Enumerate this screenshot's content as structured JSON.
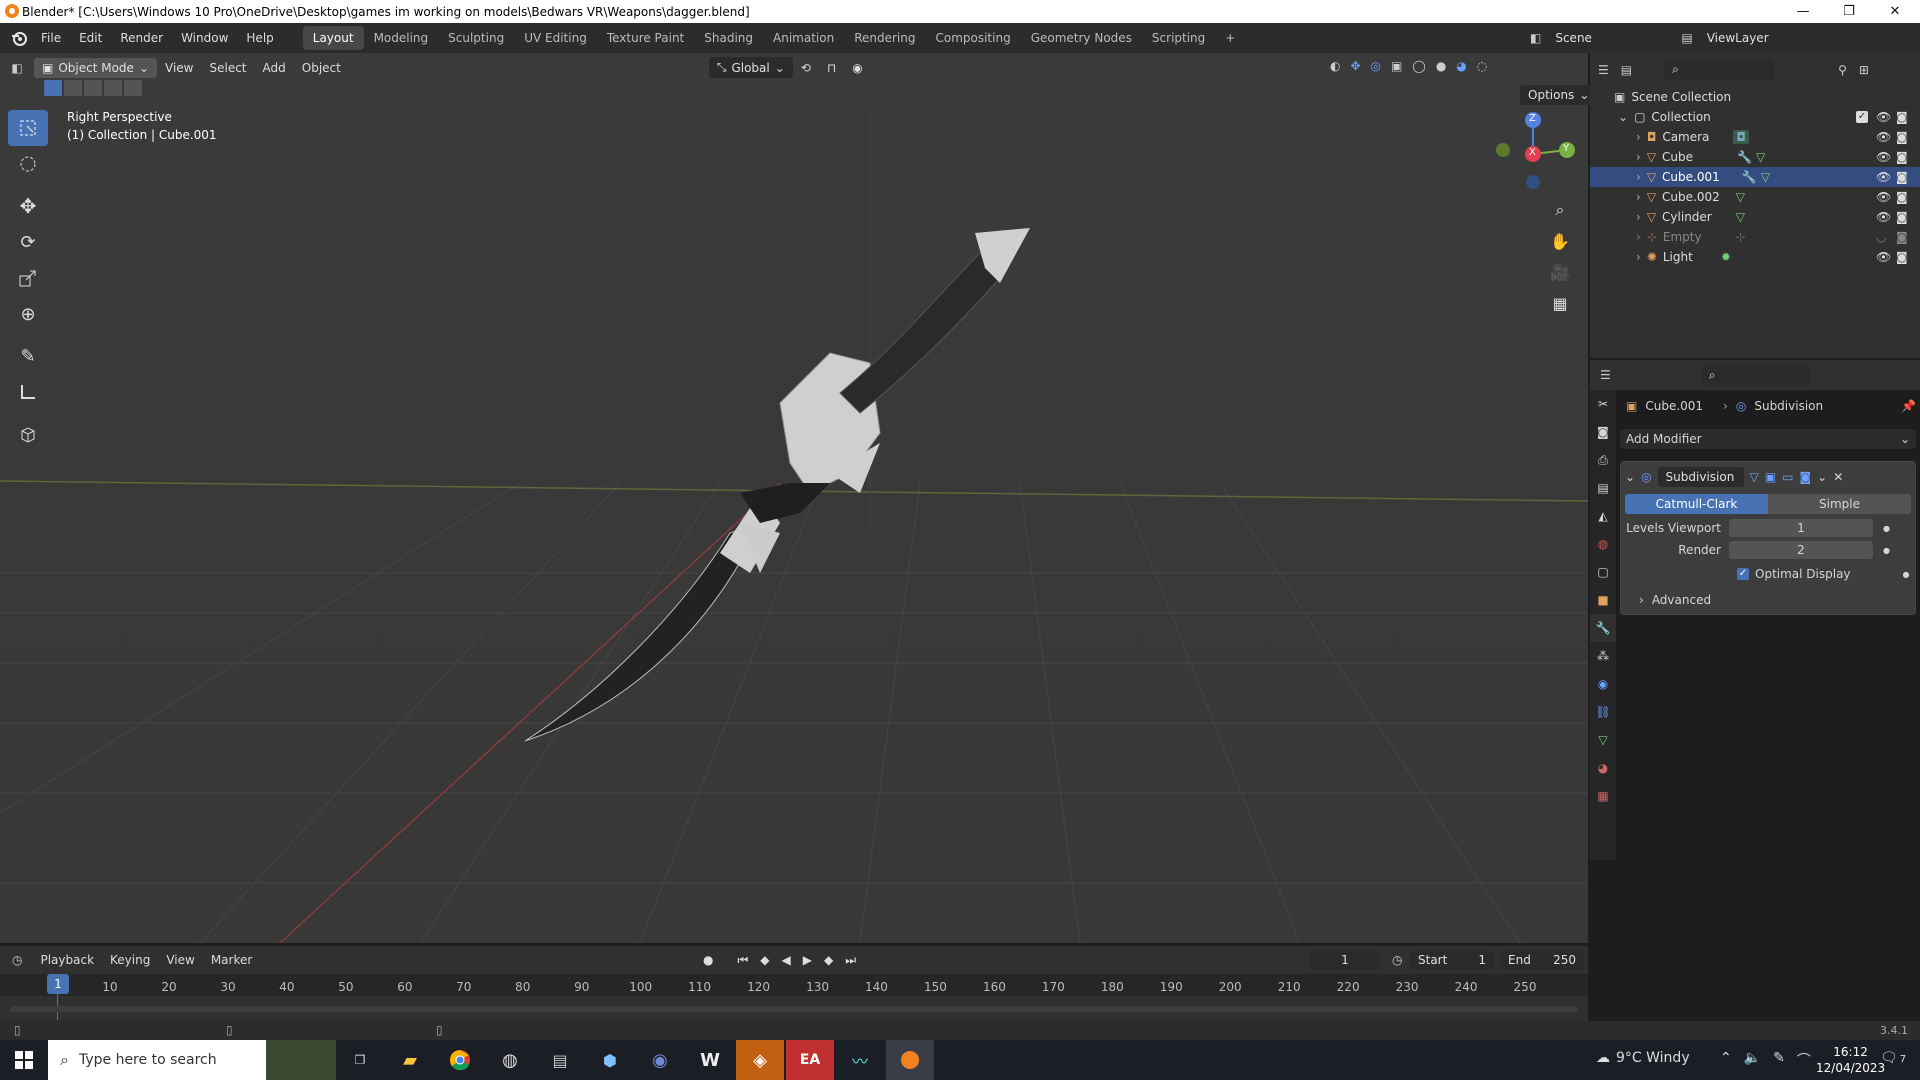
{
  "window": {
    "title": "Blender* [C:\\Users\\Windows 10 Pro\\OneDrive\\Desktop\\games im working on models\\Bedwars VR\\Weapons\\dagger.blend]",
    "controls": [
      "—",
      "❐",
      "✕"
    ]
  },
  "menubar": {
    "items": [
      "File",
      "Edit",
      "Render",
      "Window",
      "Help"
    ],
    "workspaces": [
      "Layout",
      "Modeling",
      "Sculpting",
      "UV Editing",
      "Texture Paint",
      "Shading",
      "Animation",
      "Rendering",
      "Compositing",
      "Geometry Nodes",
      "Scripting"
    ],
    "active_workspace": "Layout",
    "scene": "Scene",
    "view_layer": "ViewLayer"
  },
  "viewport": {
    "mode": "Object Mode",
    "menus": [
      "View",
      "Select",
      "Add",
      "Object"
    ],
    "orientation": "Global",
    "options_label": "Options",
    "info_line1": "Right Perspective",
    "info_line2": "(1) Collection | Cube.001",
    "gizmo_axes": [
      "Z",
      "Y",
      "X"
    ],
    "tools": [
      "select-box-icon",
      "cursor-icon",
      "move-icon",
      "rotate-icon",
      "scale-icon",
      "transform-icon",
      "annotate-icon",
      "measure-icon",
      "add-cube-icon"
    ]
  },
  "outliner": {
    "root": "Scene Collection",
    "collection": "Collection",
    "items": [
      {
        "name": "Camera",
        "type": "camera"
      },
      {
        "name": "Cube",
        "type": "mesh"
      },
      {
        "name": "Cube.001",
        "type": "mesh"
      },
      {
        "name": "Cube.002",
        "type": "mesh"
      },
      {
        "name": "Cylinder",
        "type": "mesh"
      },
      {
        "name": "Empty",
        "type": "empty"
      },
      {
        "name": "Light",
        "type": "light"
      }
    ]
  },
  "properties": {
    "object": "Cube.001",
    "modifier_breadcrumb": "Subdivision",
    "add_modifier": "Add Modifier",
    "modifier_name": "Subdivision",
    "type_tabs": [
      "Catmull-Clark",
      "Simple"
    ],
    "active_type": "Catmull-Clark",
    "levels_viewport_label": "Levels Viewport",
    "levels_viewport": "1",
    "render_label": "Render",
    "render_value": "2",
    "optimal_display_label": "Optimal Display",
    "optimal_display": true,
    "advanced_label": "Advanced"
  },
  "timeline": {
    "menus": [
      "Playback",
      "Keying",
      "View",
      "Marker"
    ],
    "current_frame": "1",
    "start_label": "Start",
    "start": "1",
    "end_label": "End",
    "end": "250",
    "ticks": [
      "1",
      "10",
      "20",
      "30",
      "40",
      "50",
      "60",
      "70",
      "80",
      "90",
      "100",
      "110",
      "120",
      "130",
      "140",
      "150",
      "160",
      "170",
      "180",
      "190",
      "200",
      "210",
      "220",
      "230",
      "240",
      "250"
    ]
  },
  "status": {
    "version": "3.4.1"
  },
  "taskbar": {
    "search_placeholder": "Type here to search",
    "weather": "9°C  Windy",
    "time": "16:12",
    "date": "12/04/2023",
    "notifications": "7"
  },
  "colors": {
    "accent": "#4772b3",
    "header": "#303030",
    "viewport": "#393939"
  }
}
